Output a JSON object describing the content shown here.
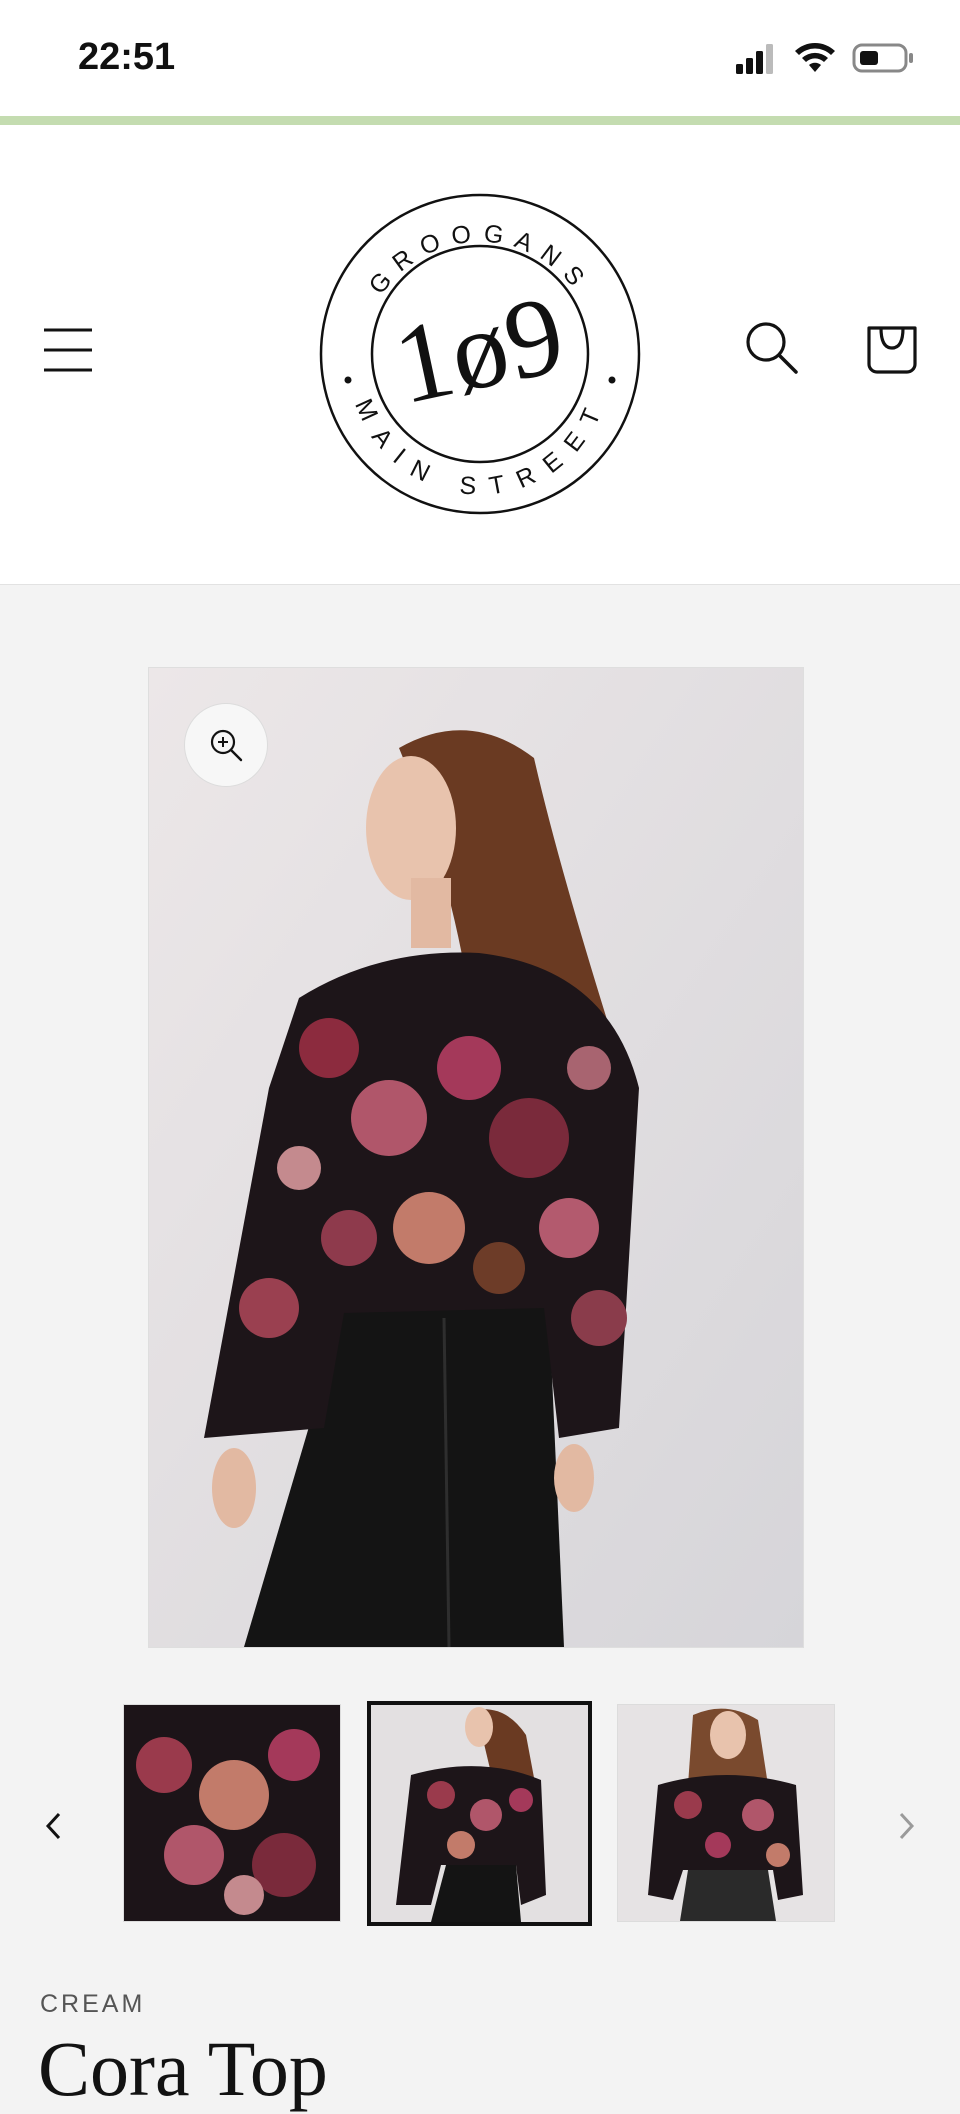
{
  "status_bar": {
    "time": "22:51"
  },
  "colors": {
    "accent_line": "#c4dcb0",
    "text": "#121212"
  },
  "header": {
    "menu_icon": "hamburger-icon",
    "search_icon": "search-icon",
    "cart_icon": "cart-icon",
    "logo": {
      "number": "1ø9",
      "top_text": "GROOGANS",
      "bottom_text": "MAIN STREET"
    }
  },
  "product": {
    "zoom_icon": "zoom-in-icon",
    "vendor": "CREAM",
    "title": "Cora Top",
    "thumbnails": [
      {
        "name": "thumbnail-back-closeup",
        "active": false
      },
      {
        "name": "thumbnail-back-view",
        "active": true
      },
      {
        "name": "thumbnail-front-view",
        "active": false
      }
    ]
  }
}
